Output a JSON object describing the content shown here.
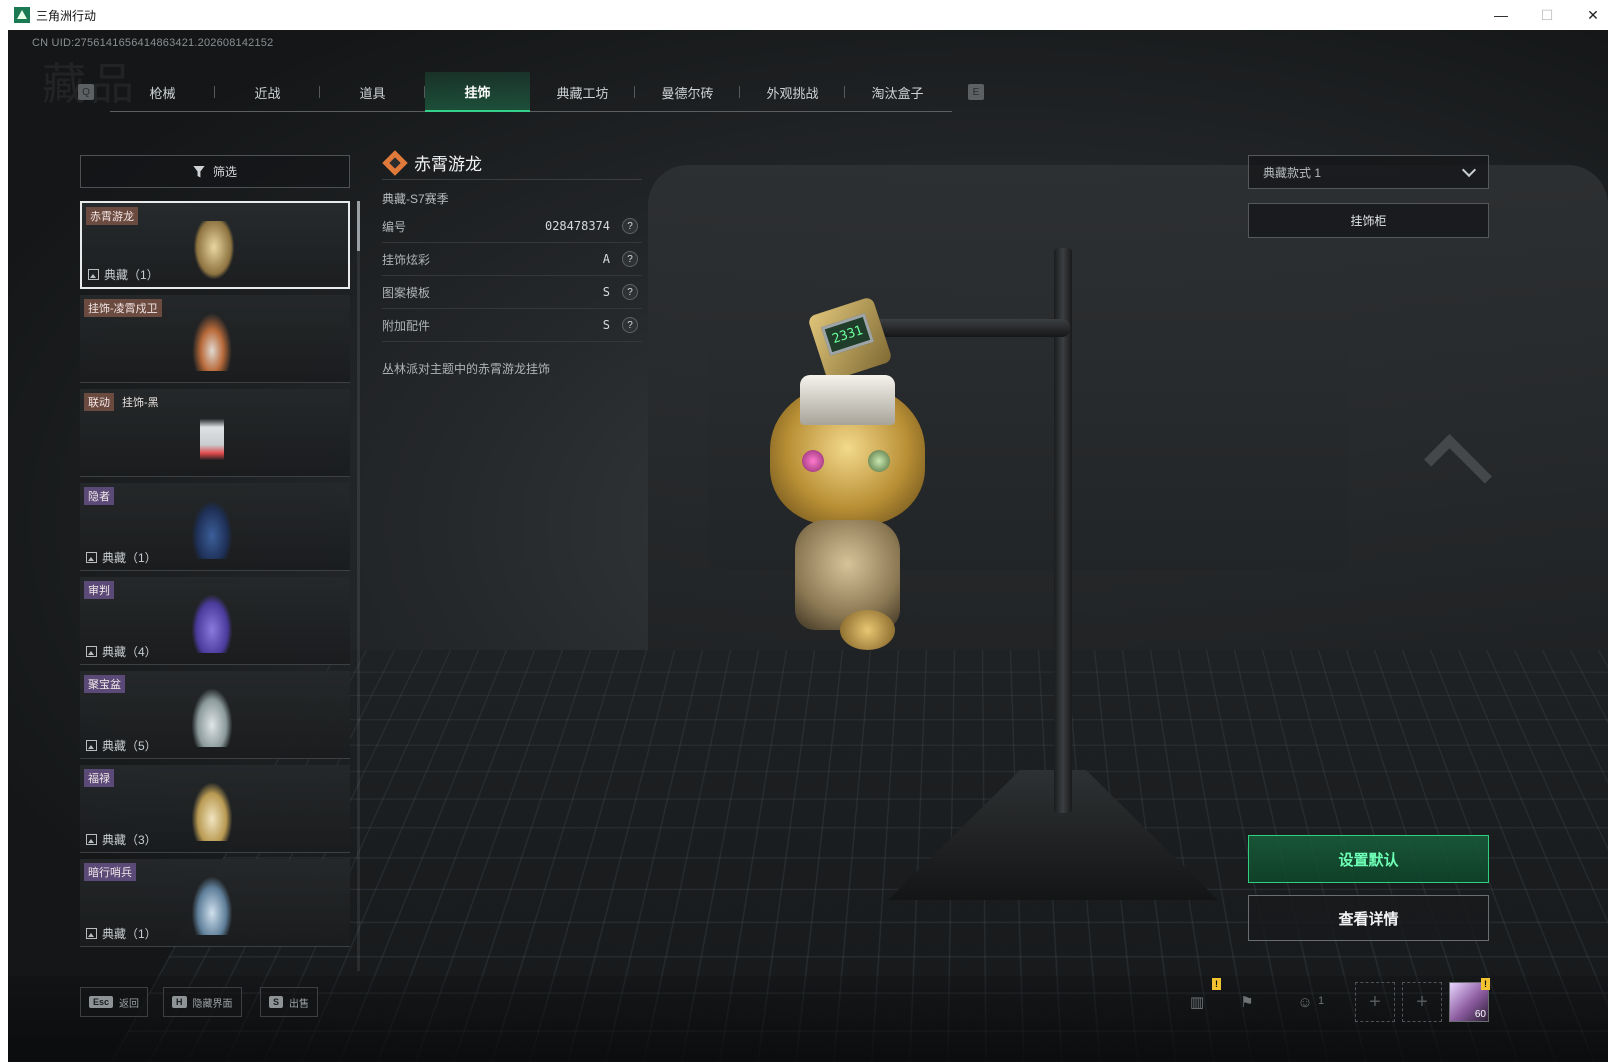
{
  "window": {
    "title": "三角洲行动",
    "minimize": "—",
    "maximize": "☐",
    "close": "✕"
  },
  "uid": "CN UID:2756141656414863421.202608142152",
  "watermark": "藏品",
  "tabs": {
    "left_key": "Q",
    "right_key": "E",
    "items": [
      {
        "label": "枪械"
      },
      {
        "label": "近战"
      },
      {
        "label": "道具"
      },
      {
        "label": "挂饰",
        "active": true
      },
      {
        "label": "典藏工坊"
      },
      {
        "label": "曼德尔砖"
      },
      {
        "label": "外观挑战"
      },
      {
        "label": "淘汰盒子"
      }
    ]
  },
  "filter": {
    "label": "筛选"
  },
  "list": {
    "items": [
      {
        "tags": [
          "赤霄游龙"
        ],
        "footer": "典藏（1）",
        "selected": true
      },
      {
        "tags": [
          "挂饰-凌霄戍卫"
        ],
        "footer": ""
      },
      {
        "tags": [
          "联动",
          "挂饰-黑"
        ],
        "footer": ""
      },
      {
        "tags": [
          "隐者"
        ],
        "footer": "典藏（1）"
      },
      {
        "tags": [
          "审判"
        ],
        "footer": "典藏（4）"
      },
      {
        "tags": [
          "聚宝盆"
        ],
        "footer": "典藏（5）"
      },
      {
        "tags": [
          "福禄"
        ],
        "footer": "典藏（3）"
      },
      {
        "tags": [
          "暗行哨兵"
        ],
        "footer": "典藏（1）"
      }
    ]
  },
  "detail": {
    "title": "赤霄游龙",
    "subtitle": "典藏-S7赛季",
    "rows": [
      {
        "label": "编号",
        "value": "028478374",
        "help": "?"
      },
      {
        "label": "挂饰炫彩",
        "value": "A",
        "help": "?"
      },
      {
        "label": "图案模板",
        "value": "S",
        "help": "?"
      },
      {
        "label": "附加配件",
        "value": "S",
        "help": "?"
      }
    ],
    "description": "丛林派对主题中的赤霄游龙挂饰"
  },
  "hammer_display": "2331",
  "style_select": {
    "value": "典藏款式 1"
  },
  "cabinet_button": "挂饰柜",
  "set_default_button": "设置默认",
  "view_detail_button": "查看详情",
  "bottom": {
    "hotkeys": [
      {
        "key": "Esc",
        "label": "返回"
      },
      {
        "key": "H",
        "label": "隐藏界面"
      },
      {
        "key": "S",
        "label": "出售"
      }
    ],
    "party_count": "1",
    "badge": "!",
    "avatar_level": "60"
  },
  "icons": [
    "app-logo-icon",
    "funnel-icon",
    "diamond-icon",
    "help-icon",
    "chevron-down-icon",
    "frame-icon",
    "stats-icon",
    "flag-icon",
    "party-icon",
    "plus-icon"
  ]
}
